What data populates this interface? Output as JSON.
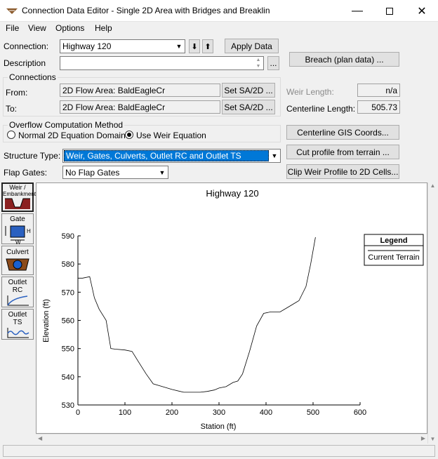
{
  "window": {
    "title": "Connection Data Editor - Single 2D Area with Bridges and Breaklin"
  },
  "menu": {
    "file": "File",
    "view": "View",
    "options": "Options",
    "help": "Help"
  },
  "connection": {
    "label": "Connection:",
    "value": "Highway 120",
    "down_arrow": "⬇",
    "up_arrow": "⬆",
    "apply_label": "Apply Data"
  },
  "description": {
    "label": "Description",
    "value": "",
    "ellipsis": "..."
  },
  "breach_button": "Breach (plan data) ...",
  "connections_group": {
    "title": "Connections",
    "from_label": "From:",
    "from_value": "2D Flow Area: BaldEagleCr",
    "from_button": "Set SA/2D ...",
    "to_label": "To:",
    "to_value": "2D Flow Area: BaldEagleCr",
    "to_button": "Set SA/2D ..."
  },
  "weir_length": {
    "label": "Weir Length:",
    "value": "n/a"
  },
  "centerline_length": {
    "label": "Centerline Length:",
    "value": "505.73"
  },
  "overflow_group": {
    "title": "Overflow Computation Method",
    "option1": "Normal 2D Equation Domain",
    "option2": "Use Weir Equation",
    "selected": "option2"
  },
  "centerline_gis_button": "Centerline GIS Coords...",
  "cut_profile_button": "Cut profile from terrain ...",
  "clip_weir_button": "Clip Weir Profile to 2D Cells...",
  "structure_type": {
    "label": "Structure Type:",
    "value": "Weir, Gates, Culverts, Outlet RC and Outlet TS"
  },
  "flap_gates": {
    "label": "Flap Gates:",
    "value": "No Flap Gates"
  },
  "side_buttons": {
    "weir": [
      "Weir /",
      "Embankment"
    ],
    "gate": [
      "Gate",
      "H",
      "W"
    ],
    "culvert": "Culvert",
    "outlet_rc": [
      "Outlet",
      "RC"
    ],
    "outlet_ts": [
      "Outlet",
      "TS"
    ]
  },
  "chart_data": {
    "type": "line",
    "title": "Highway 120",
    "xlabel": "Station (ft)",
    "ylabel": "Elevation (ft)",
    "xlim": [
      0,
      600
    ],
    "ylim": [
      530,
      590
    ],
    "xticks": [
      0,
      100,
      200,
      300,
      400,
      500,
      600
    ],
    "yticks": [
      530,
      540,
      550,
      560,
      570,
      580,
      590
    ],
    "grid": false,
    "legend": {
      "title": "Legend",
      "placement": "top-right"
    },
    "series": [
      {
        "name": "Current Terrain",
        "color": "#000000",
        "x": [
          0,
          10,
          25,
          35,
          45,
          60,
          70,
          80,
          100,
          115,
          130,
          145,
          160,
          180,
          200,
          225,
          240,
          260,
          275,
          290,
          300,
          315,
          330,
          340,
          350,
          365,
          380,
          395,
          410,
          430,
          445,
          460,
          470,
          485,
          495,
          505
        ],
        "y": [
          575,
          575,
          575.5,
          568,
          564,
          560,
          550,
          549.8,
          549.5,
          549,
          545,
          541,
          537.5,
          536.5,
          535.5,
          534.5,
          534.5,
          534.5,
          534.8,
          535.3,
          536,
          536.5,
          538,
          538.5,
          541,
          549,
          558,
          562.5,
          563,
          563,
          564.5,
          566,
          567,
          572,
          580,
          589.5
        ]
      }
    ]
  }
}
